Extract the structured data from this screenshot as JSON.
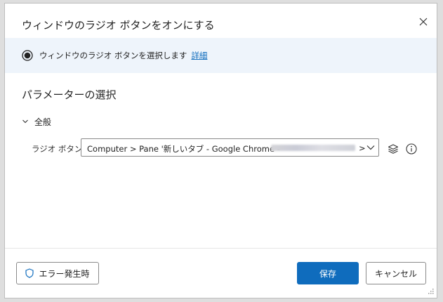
{
  "dialog": {
    "title": "ウィンドウのラジオ ボタンをオンにする",
    "info": {
      "text": "ウィンドウのラジオ ボタンを選択します",
      "link": "詳細"
    },
    "section_title": "パラメーターの選択",
    "group": {
      "label": "全般"
    },
    "field": {
      "label": "ラジオ ボタン:",
      "value_start": "Computer > Pane '新しいタブ - Google Chrome -",
      "value_end": ">"
    },
    "footer": {
      "error_button": "エラー発生時",
      "save_button": "保存",
      "cancel_button": "キャンセル"
    }
  },
  "colors": {
    "accent": "#0f6cbd",
    "info_bar_bg": "#eef4fb"
  }
}
